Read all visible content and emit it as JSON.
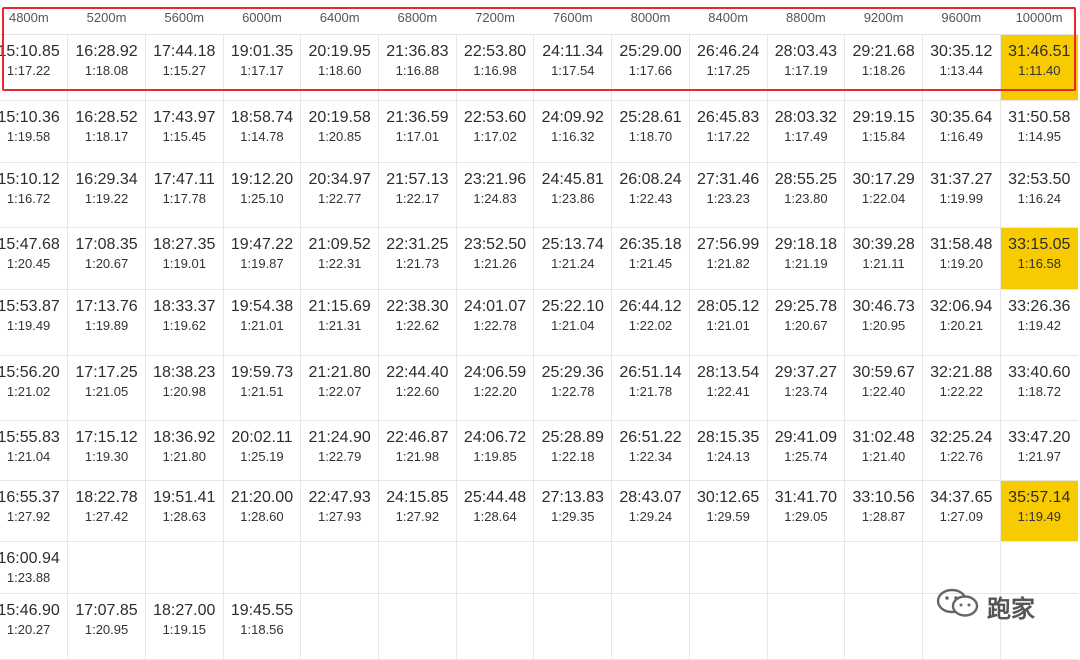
{
  "headers": [
    "4800m",
    "5200m",
    "5600m",
    "6000m",
    "6400m",
    "6800m",
    "7200m",
    "7600m",
    "8000m",
    "8400m",
    "8800m",
    "9200m",
    "9600m",
    "10000m"
  ],
  "rows": [
    {
      "cells": [
        {
          "t": "15:10.85",
          "p": "1:17.22"
        },
        {
          "t": "16:28.92",
          "p": "1:18.08"
        },
        {
          "t": "17:44.18",
          "p": "1:15.27"
        },
        {
          "t": "19:01.35",
          "p": "1:17.17"
        },
        {
          "t": "20:19.95",
          "p": "1:18.60"
        },
        {
          "t": "21:36.83",
          "p": "1:16.88"
        },
        {
          "t": "22:53.80",
          "p": "1:16.98"
        },
        {
          "t": "24:11.34",
          "p": "1:17.54"
        },
        {
          "t": "25:29.00",
          "p": "1:17.66"
        },
        {
          "t": "26:46.24",
          "p": "1:17.25"
        },
        {
          "t": "28:03.43",
          "p": "1:17.19"
        },
        {
          "t": "29:21.68",
          "p": "1:18.26"
        },
        {
          "t": "30:35.12",
          "p": "1:13.44"
        },
        {
          "t": "31:46.51",
          "p": "1:11.40",
          "hl": true
        }
      ]
    },
    {
      "cells": [
        {
          "t": "15:10.36",
          "p": "1:19.58"
        },
        {
          "t": "16:28.52",
          "p": "1:18.17"
        },
        {
          "t": "17:43.97",
          "p": "1:15.45"
        },
        {
          "t": "18:58.74",
          "p": "1:14.78"
        },
        {
          "t": "20:19.58",
          "p": "1:20.85"
        },
        {
          "t": "21:36.59",
          "p": "1:17.01"
        },
        {
          "t": "22:53.60",
          "p": "1:17.02"
        },
        {
          "t": "24:09.92",
          "p": "1:16.32"
        },
        {
          "t": "25:28.61",
          "p": "1:18.70"
        },
        {
          "t": "26:45.83",
          "p": "1:17.22"
        },
        {
          "t": "28:03.32",
          "p": "1:17.49"
        },
        {
          "t": "29:19.15",
          "p": "1:15.84"
        },
        {
          "t": "30:35.64",
          "p": "1:16.49"
        },
        {
          "t": "31:50.58",
          "p": "1:14.95"
        }
      ]
    },
    {
      "cells": [
        {
          "t": "15:10.12",
          "p": "1:16.72"
        },
        {
          "t": "16:29.34",
          "p": "1:19.22"
        },
        {
          "t": "17:47.11",
          "p": "1:17.78"
        },
        {
          "t": "19:12.20",
          "p": "1:25.10"
        },
        {
          "t": "20:34.97",
          "p": "1:22.77"
        },
        {
          "t": "21:57.13",
          "p": "1:22.17"
        },
        {
          "t": "23:21.96",
          "p": "1:24.83"
        },
        {
          "t": "24:45.81",
          "p": "1:23.86"
        },
        {
          "t": "26:08.24",
          "p": "1:22.43"
        },
        {
          "t": "27:31.46",
          "p": "1:23.23"
        },
        {
          "t": "28:55.25",
          "p": "1:23.80"
        },
        {
          "t": "30:17.29",
          "p": "1:22.04"
        },
        {
          "t": "31:37.27",
          "p": "1:19.99"
        },
        {
          "t": "32:53.50",
          "p": "1:16.24"
        }
      ]
    },
    {
      "cells": [
        {
          "t": "15:47.68",
          "p": "1:20.45"
        },
        {
          "t": "17:08.35",
          "p": "1:20.67"
        },
        {
          "t": "18:27.35",
          "p": "1:19.01"
        },
        {
          "t": "19:47.22",
          "p": "1:19.87"
        },
        {
          "t": "21:09.52",
          "p": "1:22.31"
        },
        {
          "t": "22:31.25",
          "p": "1:21.73"
        },
        {
          "t": "23:52.50",
          "p": "1:21.26"
        },
        {
          "t": "25:13.74",
          "p": "1:21.24"
        },
        {
          "t": "26:35.18",
          "p": "1:21.45"
        },
        {
          "t": "27:56.99",
          "p": "1:21.82"
        },
        {
          "t": "29:18.18",
          "p": "1:21.19"
        },
        {
          "t": "30:39.28",
          "p": "1:21.11"
        },
        {
          "t": "31:58.48",
          "p": "1:19.20"
        },
        {
          "t": "33:15.05",
          "p": "1:16.58",
          "hl": true
        }
      ]
    },
    {
      "cells": [
        {
          "t": "15:53.87",
          "p": "1:19.49"
        },
        {
          "t": "17:13.76",
          "p": "1:19.89"
        },
        {
          "t": "18:33.37",
          "p": "1:19.62"
        },
        {
          "t": "19:54.38",
          "p": "1:21.01"
        },
        {
          "t": "21:15.69",
          "p": "1:21.31"
        },
        {
          "t": "22:38.30",
          "p": "1:22.62"
        },
        {
          "t": "24:01.07",
          "p": "1:22.78"
        },
        {
          "t": "25:22.10",
          "p": "1:21.04"
        },
        {
          "t": "26:44.12",
          "p": "1:22.02"
        },
        {
          "t": "28:05.12",
          "p": "1:21.01"
        },
        {
          "t": "29:25.78",
          "p": "1:20.67"
        },
        {
          "t": "30:46.73",
          "p": "1:20.95"
        },
        {
          "t": "32:06.94",
          "p": "1:20.21"
        },
        {
          "t": "33:26.36",
          "p": "1:19.42"
        }
      ]
    },
    {
      "cells": [
        {
          "t": "15:56.20",
          "p": "1:21.02"
        },
        {
          "t": "17:17.25",
          "p": "1:21.05"
        },
        {
          "t": "18:38.23",
          "p": "1:20.98"
        },
        {
          "t": "19:59.73",
          "p": "1:21.51"
        },
        {
          "t": "21:21.80",
          "p": "1:22.07"
        },
        {
          "t": "22:44.40",
          "p": "1:22.60"
        },
        {
          "t": "24:06.59",
          "p": "1:22.20"
        },
        {
          "t": "25:29.36",
          "p": "1:22.78"
        },
        {
          "t": "26:51.14",
          "p": "1:21.78"
        },
        {
          "t": "28:13.54",
          "p": "1:22.41"
        },
        {
          "t": "29:37.27",
          "p": "1:23.74"
        },
        {
          "t": "30:59.67",
          "p": "1:22.40"
        },
        {
          "t": "32:21.88",
          "p": "1:22.22"
        },
        {
          "t": "33:40.60",
          "p": "1:18.72"
        }
      ]
    },
    {
      "cells": [
        {
          "t": "15:55.83",
          "p": "1:21.04"
        },
        {
          "t": "17:15.12",
          "p": "1:19.30"
        },
        {
          "t": "18:36.92",
          "p": "1:21.80"
        },
        {
          "t": "20:02.11",
          "p": "1:25.19"
        },
        {
          "t": "21:24.90",
          "p": "1:22.79"
        },
        {
          "t": "22:46.87",
          "p": "1:21.98"
        },
        {
          "t": "24:06.72",
          "p": "1:19.85"
        },
        {
          "t": "25:28.89",
          "p": "1:22.18"
        },
        {
          "t": "26:51.22",
          "p": "1:22.34"
        },
        {
          "t": "28:15.35",
          "p": "1:24.13"
        },
        {
          "t": "29:41.09",
          "p": "1:25.74"
        },
        {
          "t": "31:02.48",
          "p": "1:21.40"
        },
        {
          "t": "32:25.24",
          "p": "1:22.76"
        },
        {
          "t": "33:47.20",
          "p": "1:21.97"
        }
      ]
    },
    {
      "cells": [
        {
          "t": "16:55.37",
          "p": "1:27.92"
        },
        {
          "t": "18:22.78",
          "p": "1:27.42"
        },
        {
          "t": "19:51.41",
          "p": "1:28.63"
        },
        {
          "t": "21:20.00",
          "p": "1:28.60"
        },
        {
          "t": "22:47.93",
          "p": "1:27.93"
        },
        {
          "t": "24:15.85",
          "p": "1:27.92"
        },
        {
          "t": "25:44.48",
          "p": "1:28.64"
        },
        {
          "t": "27:13.83",
          "p": "1:29.35"
        },
        {
          "t": "28:43.07",
          "p": "1:29.24"
        },
        {
          "t": "30:12.65",
          "p": "1:29.59"
        },
        {
          "t": "31:41.70",
          "p": "1:29.05"
        },
        {
          "t": "33:10.56",
          "p": "1:28.87"
        },
        {
          "t": "34:37.65",
          "p": "1:27.09"
        },
        {
          "t": "35:57.14",
          "p": "1:19.49",
          "hl": true
        }
      ]
    },
    {
      "cells": [
        {
          "t": "16:00.94",
          "p": "1:23.88"
        }
      ]
    },
    {
      "cells": [
        {
          "t": "15:46.90",
          "p": "1:20.27"
        },
        {
          "t": "17:07.85",
          "p": "1:20.95"
        },
        {
          "t": "18:27.00",
          "p": "1:19.15"
        },
        {
          "t": "19:45.55",
          "p": "1:18.56"
        }
      ]
    }
  ],
  "watermark": {
    "label": "跑家",
    "icon": "wechat-icon"
  },
  "colors": {
    "highlight": "#f8ca00",
    "box": "#e8262d"
  }
}
